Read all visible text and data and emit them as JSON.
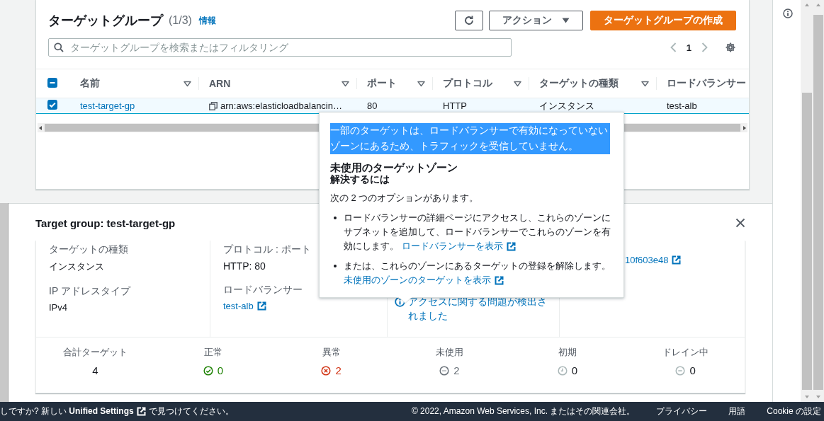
{
  "target_groups": {
    "title": "ターゲットグループ",
    "count": "(1/3)",
    "info_link": "情報",
    "actions_button": "アクション",
    "create_button": "ターゲットグループの作成",
    "search": {
      "placeholder": "ターゲットグループを検索またはフィルタリング"
    },
    "pagination": {
      "page": "1"
    },
    "table": {
      "all_checkbox": {
        "indeterminate": true
      },
      "columns": [
        {
          "label": "名前",
          "sortable": true
        },
        {
          "label": "ARN",
          "sortable": true
        },
        {
          "label": "ポート",
          "sortable": true
        },
        {
          "label": "プロトコル",
          "sortable": true
        },
        {
          "label": "ターゲットの種類",
          "sortable": true
        },
        {
          "label": "ロードバランサー",
          "sortable": false
        }
      ],
      "rows": [
        {
          "selected": true,
          "name": "test-target-gp",
          "arn": "arn:aws:elasticloadbalancin…",
          "port": "80",
          "protocol": "HTTP",
          "target_type": "インスタンス",
          "load_balancer": "test-alb"
        }
      ]
    }
  },
  "popover": {
    "message": "一部のターゲットは、ロードバランサーで有効になっていないゾーンにあるため、トラフィックを受信していません。",
    "message_selected": true,
    "heading": "未使用のターゲットゾーン",
    "subheading": "解決するには",
    "intro": "次の 2 つのオプションがあります。",
    "options": [
      {
        "text": "ロードバランサーの詳細ページにアクセスし、これらのゾーンにサブネットを追加して、ロードバランサーでこれらのゾーンを有効にします。",
        "link": "ロードバランサーを表示"
      },
      {
        "text": "または、これらのゾーンにあるターゲットの登録を解除します。",
        "link": "未使用のゾーンのターゲットを表示"
      }
    ]
  },
  "details_panel": {
    "title": "Target group: test-target-gp",
    "columns": [
      {
        "fields": [
          {
            "label": "ターゲットの種類",
            "value": "インスタンス",
            "kind": "text"
          },
          {
            "label": "IP アドレスタイプ",
            "value": "IPv4",
            "kind": "text"
          }
        ]
      },
      {
        "fields": [
          {
            "label": "プロトコル : ポート",
            "value": "HTTP: 80",
            "kind": "text"
          },
          {
            "label": "ロードバランサー",
            "value": "test-alb",
            "kind": "link"
          }
        ]
      },
      {
        "fields": [
          {
            "value": "アクセスに関する問題が検出されました",
            "kind": "info-link"
          }
        ]
      },
      {
        "fields": [
          {
            "value": "10f603e48",
            "kind": "link"
          }
        ]
      }
    ],
    "summary": [
      {
        "label": "合計ターゲット",
        "value": "4",
        "kind": "total",
        "color": "#16191f"
      },
      {
        "label": "正常",
        "value": "0",
        "kind": "healthy",
        "color": "#1d8102"
      },
      {
        "label": "異常",
        "value": "2",
        "kind": "unhealthy",
        "color": "#d13212"
      },
      {
        "label": "未使用",
        "value": "2",
        "kind": "unused",
        "color": "#687078"
      },
      {
        "label": "初期",
        "value": "0",
        "kind": "initial",
        "color": "#16191f"
      },
      {
        "label": "ドレイン中",
        "value": "0",
        "kind": "draining",
        "color": "#16191f"
      }
    ]
  },
  "footer": {
    "notice_start": "しですか? 新しい **Unified Settings**",
    "notice_end": "で見つけてください。",
    "copyright": "© 2022, Amazon Web Services, Inc. またはその関連会社。",
    "links": [
      "プライバシー",
      "用語",
      "Cookie の設定"
    ]
  }
}
